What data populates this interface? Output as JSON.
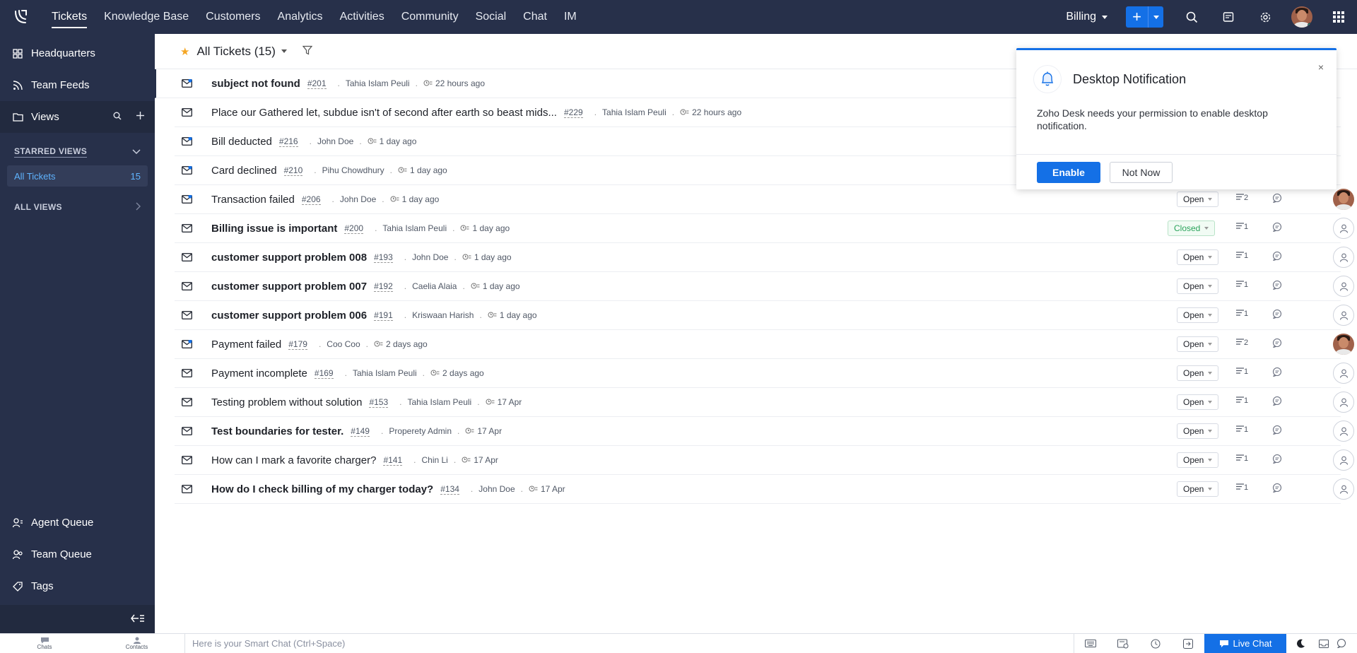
{
  "topnav": {
    "items": [
      "Tickets",
      "Knowledge Base",
      "Customers",
      "Analytics",
      "Activities",
      "Community",
      "Social",
      "Chat",
      "IM"
    ],
    "department": "Billing",
    "add_label": "+"
  },
  "sidebar": {
    "headquarters": "Headquarters",
    "team_feeds": "Team Feeds",
    "views": "Views",
    "starred_views": "STARRED VIEWS",
    "starred_item": {
      "label": "All Tickets",
      "count": "15"
    },
    "all_views": "ALL VIEWS",
    "agent_queue": "Agent Queue",
    "team_queue": "Team Queue",
    "tags": "Tags"
  },
  "list": {
    "title": "All Tickets (15)"
  },
  "tickets": [
    {
      "subject": "subject not found",
      "number": "#201",
      "contact": "Tahia Islam Peuli",
      "time": "22 hours ago",
      "status": "",
      "threads": "",
      "bold": true
    },
    {
      "subject": "Place our Gathered let, subdue isn't of second after earth so beast mids...",
      "number": "#229",
      "contact": "Tahia Islam Peuli",
      "time": "22 hours ago",
      "status": "",
      "threads": "",
      "bold": false
    },
    {
      "subject": "Bill deducted",
      "number": "#216",
      "contact": "John Doe",
      "time": "1 day ago",
      "status": "",
      "threads": "",
      "bold": false
    },
    {
      "subject": "Card declined",
      "number": "#210",
      "contact": "Pihu Chowdhury",
      "time": "1 day ago",
      "status": "",
      "threads": "",
      "bold": false
    },
    {
      "subject": "Transaction failed",
      "number": "#206",
      "contact": "John Doe",
      "time": "1 day ago",
      "status": "Open",
      "threads": "2",
      "bold": false
    },
    {
      "subject": "Billing issue is important",
      "number": "#200",
      "contact": "Tahia Islam Peuli",
      "time": "1 day ago",
      "status": "Closed",
      "threads": "1",
      "bold": true
    },
    {
      "subject": "customer support problem 008",
      "number": "#193",
      "contact": "John Doe",
      "time": "1 day ago",
      "status": "Open",
      "threads": "1",
      "bold": true
    },
    {
      "subject": "customer support problem 007",
      "number": "#192",
      "contact": "Caelia Alaia",
      "time": "1 day ago",
      "status": "Open",
      "threads": "1",
      "bold": true
    },
    {
      "subject": "customer support problem 006",
      "number": "#191",
      "contact": "Kriswaan Harish",
      "time": "1 day ago",
      "status": "Open",
      "threads": "1",
      "bold": true
    },
    {
      "subject": "Payment failed",
      "number": "#179",
      "contact": "Coo Coo",
      "time": "2 days ago",
      "status": "Open",
      "threads": "2",
      "bold": false
    },
    {
      "subject": "Payment incomplete",
      "number": "#169",
      "contact": "Tahia Islam Peuli",
      "time": "2 days ago",
      "status": "Open",
      "threads": "1",
      "bold": false
    },
    {
      "subject": "Testing problem without solution",
      "number": "#153",
      "contact": "Tahia Islam Peuli",
      "time": "17 Apr",
      "status": "Open",
      "threads": "1",
      "bold": false
    },
    {
      "subject": "Test boundaries for tester.",
      "number": "#149",
      "contact": "Properety Admin",
      "time": "17 Apr",
      "status": "Open",
      "threads": "1",
      "bold": true
    },
    {
      "subject": "How can I mark a favorite charger?",
      "number": "#141",
      "contact": "Chin Li",
      "time": "17 Apr",
      "status": "Open",
      "threads": "1",
      "bold": false
    },
    {
      "subject": "How do I check billing of my charger today?",
      "number": "#134",
      "contact": "John Doe",
      "time": "17 Apr",
      "status": "Open",
      "threads": "1",
      "bold": true
    }
  ],
  "notification": {
    "title": "Desktop Notification",
    "message": "Zoho Desk needs your permission to enable desktop notification.",
    "enable": "Enable",
    "not_now": "Not Now",
    "close": "×"
  },
  "bottombar": {
    "chats": "Chats",
    "contacts": "Contacts",
    "smartchat_placeholder": "Here is your Smart Chat (Ctrl+Space)",
    "livechat": "Live Chat"
  },
  "colors": {
    "nav_bg": "#27304a",
    "accent": "#1470e6",
    "closed": "#2aa35b"
  }
}
